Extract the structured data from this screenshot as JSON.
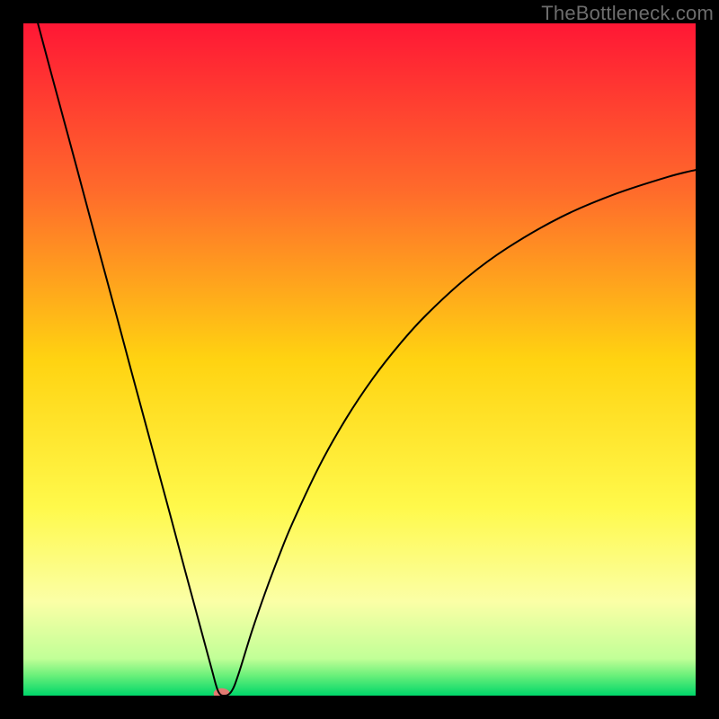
{
  "watermark": "TheBottleneck.com",
  "chart_data": {
    "type": "line",
    "title": "",
    "xlabel": "",
    "ylabel": "",
    "xlim": [
      0,
      100
    ],
    "ylim": [
      0,
      100
    ],
    "grid": false,
    "background_gradient_stops": [
      {
        "offset": 0.0,
        "color": "#ff1735"
      },
      {
        "offset": 0.25,
        "color": "#ff6b2b"
      },
      {
        "offset": 0.5,
        "color": "#ffd311"
      },
      {
        "offset": 0.72,
        "color": "#fff94b"
      },
      {
        "offset": 0.86,
        "color": "#fbffa6"
      },
      {
        "offset": 0.945,
        "color": "#c1ff97"
      },
      {
        "offset": 0.97,
        "color": "#6af07a"
      },
      {
        "offset": 1.0,
        "color": "#00d66a"
      }
    ],
    "series": [
      {
        "name": "bottleneck-curve",
        "x": [
          0,
          2,
          4,
          6,
          8,
          10,
          12,
          14,
          16,
          18,
          20,
          22,
          24,
          26,
          28,
          29,
          30,
          31,
          32,
          34,
          36,
          38,
          40,
          44,
          48,
          52,
          56,
          60,
          66,
          72,
          80,
          88,
          96,
          100
        ],
        "y": [
          108,
          100.6,
          93.1,
          85.7,
          78.3,
          70.8,
          63.4,
          56.0,
          48.5,
          41.1,
          33.7,
          26.3,
          18.8,
          11.4,
          4.0,
          0.6,
          0.0,
          0.7,
          3.2,
          9.6,
          15.4,
          20.7,
          25.6,
          34.1,
          41.2,
          47.2,
          52.3,
          56.7,
          62.2,
          66.6,
          71.2,
          74.6,
          77.2,
          78.2
        ]
      }
    ],
    "marker": {
      "name": "optimal-point",
      "x": 29.5,
      "y": 0.3,
      "color": "#e37a72",
      "rx": 9,
      "ry": 6
    }
  }
}
